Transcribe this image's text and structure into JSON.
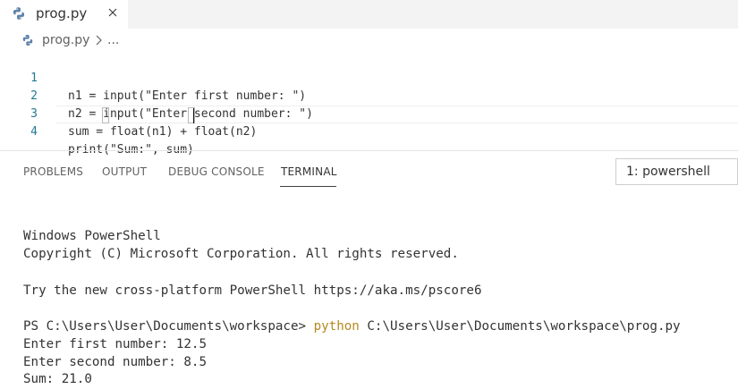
{
  "tab": {
    "filename": "prog.py",
    "icon": "python-file-icon",
    "close_icon": "close-icon"
  },
  "breadcrumb": {
    "file": "prog.py",
    "separator_icon": "chevron-right-icon",
    "more": "..."
  },
  "editor": {
    "lines": [
      {
        "number": "1",
        "code": "n1 = input(\"Enter first number: \")"
      },
      {
        "number": "2",
        "code": "n2 = input(\"Enter second number: \")"
      },
      {
        "number": "3",
        "code": "sum = float(n1) + float(n2)"
      },
      {
        "number": "4",
        "code": "print(\"Sum:\", sum)"
      }
    ]
  },
  "panel": {
    "tabs": [
      {
        "label": "PROBLEMS",
        "active": false
      },
      {
        "label": "OUTPUT",
        "active": false
      },
      {
        "label": "DEBUG CONSOLE",
        "active": false
      },
      {
        "label": "TERMINAL",
        "active": true
      }
    ],
    "terminal_select": "1: powershell"
  },
  "terminal": {
    "header_title": "Windows PowerShell",
    "copyright": "Copyright (C) Microsoft Corporation. All rights reserved.",
    "tip": "Try the new cross-platform PowerShell https://aka.ms/pscore6",
    "prompt": "PS C:\\Users\\User\\Documents\\workspace> ",
    "command_keyword": "python",
    "command_args": " C:\\Users\\User\\Documents\\workspace\\prog.py",
    "output": [
      "Enter first number: 12.5",
      "Enter second number: 8.5",
      "Sum: 21.0"
    ]
  },
  "colors": {
    "line_number": "#237893",
    "command_keyword": "#b5891f",
    "tab_bar_bg": "#f3f3f3",
    "active_tab_underline": "#424242"
  }
}
